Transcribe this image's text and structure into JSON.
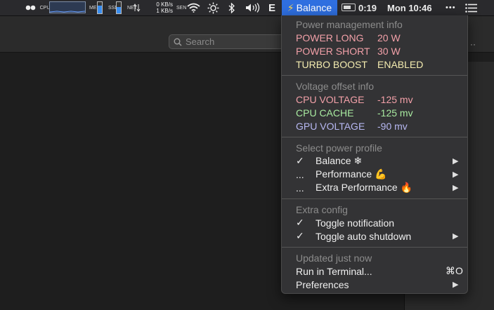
{
  "menubar": {
    "cpu_label": "CPU",
    "mem_label": "MEM",
    "ssd_label": "SSD",
    "net_label": "NET",
    "net_up": "0 KB/s",
    "net_down": "1 KB/s",
    "sen_label": "SEN",
    "e_label": "E",
    "active_app": "Balance",
    "battery_time": "0:19",
    "clock": "Mon 10:46",
    "more": "•••",
    "mem_level": 0.7,
    "ssd_level": 0.55
  },
  "window": {
    "search": {
      "placeholder": "Search"
    },
    "pane_dots": "··"
  },
  "menu": {
    "power": {
      "header": "Power management info",
      "rows": [
        {
          "label": "POWER LONG",
          "value": "20 W"
        },
        {
          "label": "POWER SHORT",
          "value": "30 W"
        },
        {
          "label": "TURBO BOOST",
          "value": "ENABLED"
        }
      ]
    },
    "voltage": {
      "header": "Voltage offset info",
      "rows": [
        {
          "label": "CPU VOLTAGE",
          "value": "-125 mv"
        },
        {
          "label": "CPU CACHE",
          "value": "-125 mv"
        },
        {
          "label": "GPU VOLTAGE",
          "value": "-90 mv"
        }
      ]
    },
    "profile": {
      "header": "Select power profile",
      "items": [
        {
          "mark": "✓",
          "label": "Balance ❄"
        },
        {
          "mark": "...",
          "label": "Performance 💪"
        },
        {
          "mark": "...",
          "label": "Extra Performance 🔥"
        }
      ]
    },
    "extra": {
      "header": "Extra config",
      "items": [
        {
          "mark": "✓",
          "label": "Toggle notification"
        },
        {
          "mark": "✓",
          "label": "Toggle auto shutdown"
        }
      ]
    },
    "footer": {
      "updated": "Updated just now",
      "run": "Run in Terminal...",
      "run_shortcut": "⌘O",
      "prefs": "Preferences"
    }
  }
}
